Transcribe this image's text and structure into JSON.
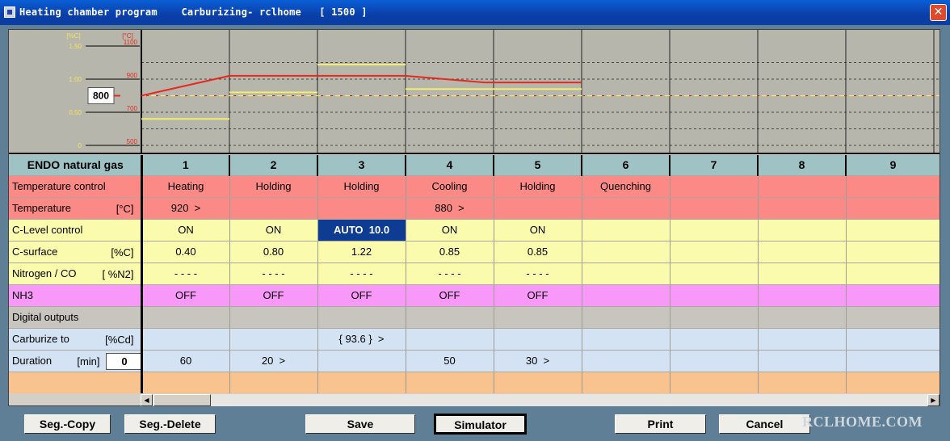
{
  "window": {
    "title": "Heating chamber program    Carburizing- rclhome   [ 1500 ]",
    "close_label": "✕",
    "watermark": "RCLHOME.COM"
  },
  "chart_data": {
    "type": "line",
    "y_axis_left": {
      "unit": "[%C]",
      "ticks": [
        "1.50",
        "1.00",
        "0.50",
        "0"
      ]
    },
    "y_axis_right": {
      "unit": "[°C]",
      "ticks": [
        "1100",
        "900",
        "700",
        "500"
      ]
    },
    "ylim_temp": [
      500,
      1100
    ],
    "ylim_carbon": [
      0,
      1.5
    ],
    "setpoint_label": "800",
    "segments": [
      1,
      2,
      3,
      4,
      5,
      6,
      7,
      8,
      9
    ],
    "temperature_series": {
      "start": 800,
      "values": [
        920,
        920,
        920,
        880,
        880
      ]
    },
    "carbon_series": {
      "values": [
        0.4,
        0.8,
        1.22,
        0.85,
        0.85
      ]
    },
    "reference_line": 800,
    "colors": {
      "temperature": "#e8281c",
      "carbon": "#f4ec6c",
      "grid": "#222222",
      "plot_bg": "#b7b6ad",
      "left_axis": "#f4e35a",
      "right_axis": "#e8281c"
    }
  },
  "grid": {
    "header_label": "ENDO natural gas",
    "columns": [
      "1",
      "2",
      "3",
      "4",
      "5",
      "6",
      "7",
      "8",
      "9"
    ],
    "rows": [
      {
        "label": "Temperature control",
        "unit": "",
        "style": "tmp",
        "cells": [
          "Heating",
          "Holding",
          "Holding",
          "Cooling",
          "Holding",
          "Quenching",
          "",
          "",
          ""
        ]
      },
      {
        "label": "Temperature",
        "unit": "[°C]",
        "style": "tmp",
        "cells": [
          "920  >",
          "",
          "",
          "880  >",
          "",
          "",
          "",
          "",
          ""
        ]
      },
      {
        "label": "C-Level control",
        "unit": "",
        "style": "yel",
        "cells": [
          "ON",
          "ON",
          "AUTO  10.0",
          "ON",
          "ON",
          "",
          "",
          "",
          ""
        ]
      },
      {
        "label": "C-surface",
        "unit": "[%C]",
        "style": "yel",
        "cells": [
          "0.40",
          "0.80",
          "1.22",
          "0.85",
          "0.85",
          "",
          "",
          "",
          ""
        ]
      },
      {
        "label": "Nitrogen / CO",
        "unit": "[ %N2]",
        "style": "yel",
        "cells": [
          "- - - -",
          "- - - -",
          "- - - -",
          "- - - -",
          "- - - -",
          "",
          "",
          "",
          ""
        ]
      },
      {
        "label": "NH3",
        "unit": "",
        "style": "pink",
        "cells": [
          "OFF",
          "OFF",
          "OFF",
          "OFF",
          "OFF",
          "",
          "",
          "",
          ""
        ]
      },
      {
        "label": "Digital outputs",
        "unit": "",
        "style": "gry",
        "cells": [
          "",
          "",
          "",
          "",
          "",
          "",
          "",
          "",
          ""
        ]
      },
      {
        "label": "Carburize to",
        "unit": "[%Cd]",
        "style": "blu",
        "cells": [
          "",
          "",
          "{ 93.6 }  >",
          "",
          "",
          "",
          "",
          "",
          ""
        ]
      },
      {
        "label": "Duration",
        "unit": "[min]",
        "style": "blu",
        "cells": [
          "60",
          "20  >",
          "",
          "50",
          "30  >",
          "",
          "",
          "",
          ""
        ]
      },
      {
        "label": "",
        "unit": "",
        "style": "org",
        "cells": [
          "",
          "",
          "",
          "",
          "",
          "",
          "",
          "",
          ""
        ]
      }
    ],
    "duration_input": "0"
  },
  "scrollbar": {
    "left_arrow": "◀",
    "right_arrow": "▶"
  },
  "buttons": {
    "seg_copy": "Seg.-Copy",
    "seg_delete": "Seg.-Delete",
    "save": "Save",
    "simulator": "Simulator",
    "print": "Print",
    "cancel": "Cancel"
  }
}
